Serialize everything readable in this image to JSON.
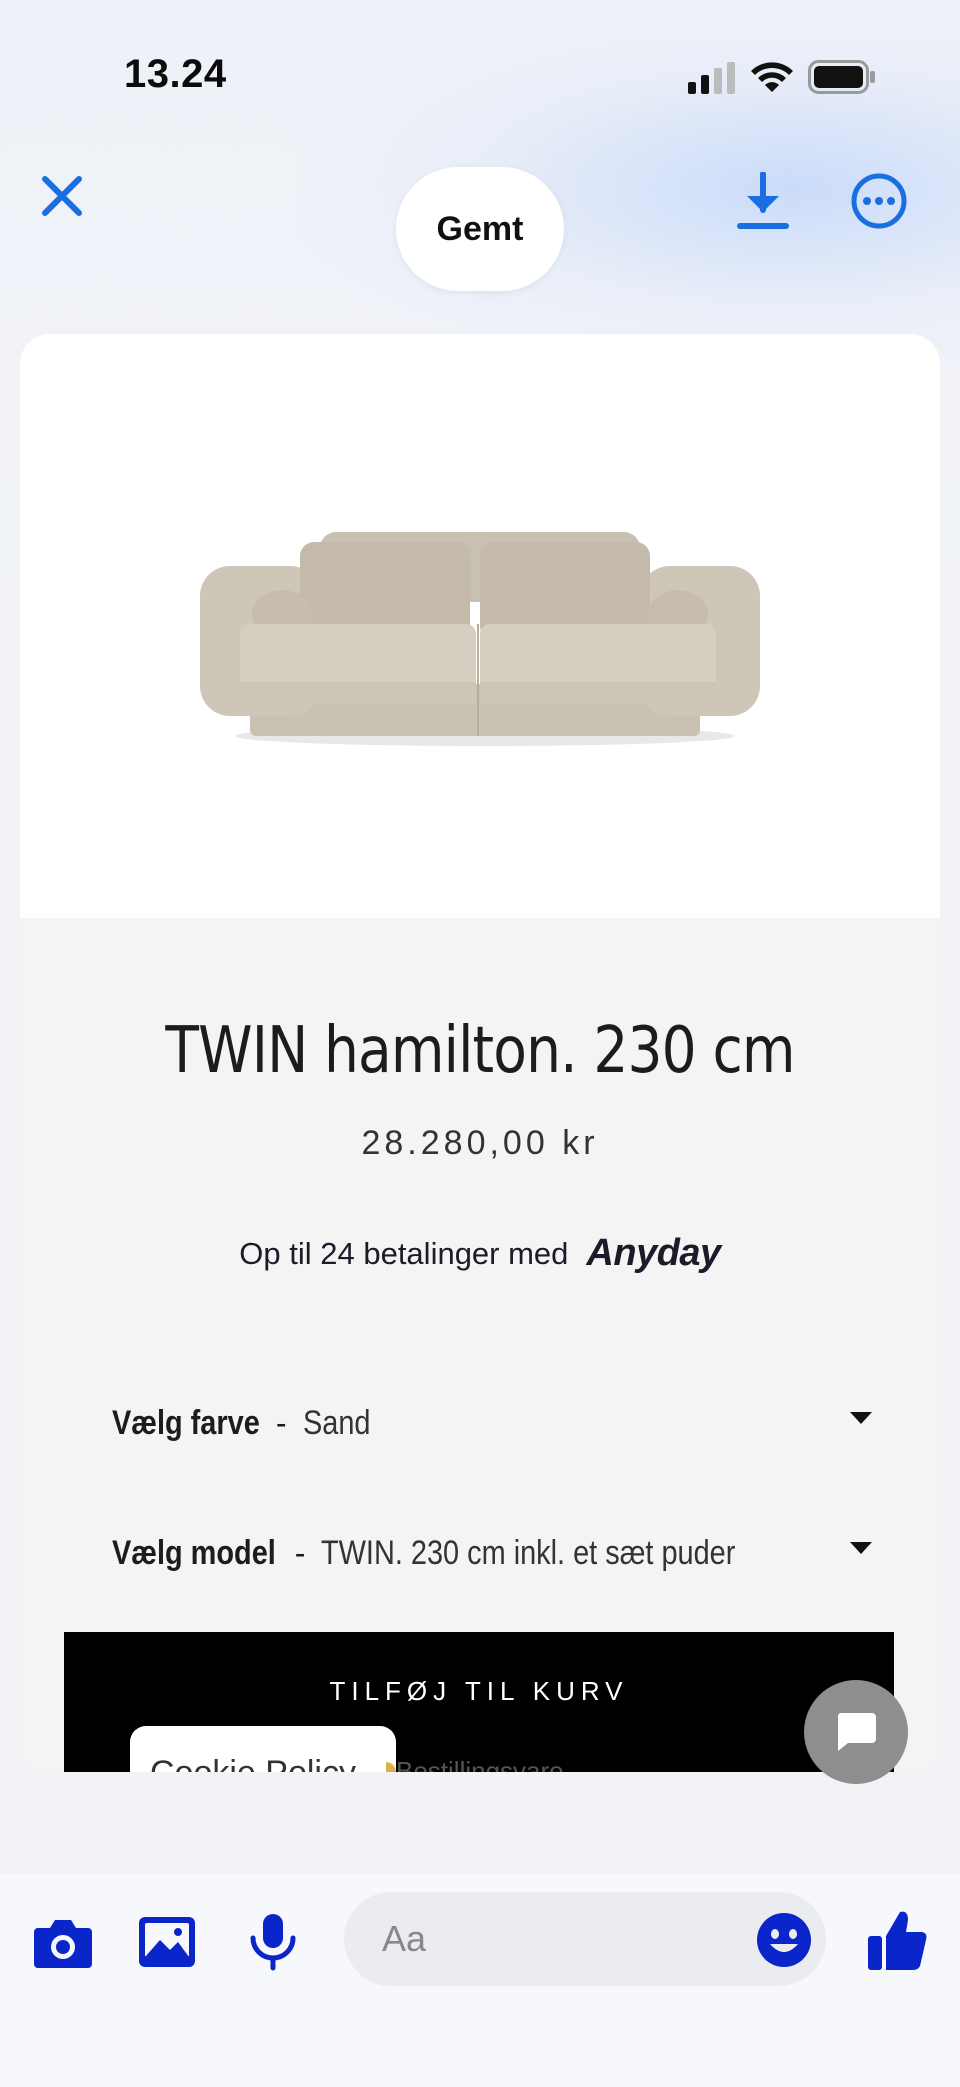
{
  "status_bar": {
    "time": "13.24"
  },
  "top_bar": {
    "saved_label": "Gemt",
    "icons": {
      "close": "close-icon",
      "download": "download-icon",
      "more": "more-icon"
    },
    "accent_color": "#1a6fe0"
  },
  "product": {
    "image": "sofa-image",
    "title": "TWIN hamilton. 230 cm",
    "price": "28.280,00 kr",
    "installments_text": "Op til 24 betalinger med",
    "installments_brand": "Anyday",
    "options": [
      {
        "label": "Vælg farve",
        "separator": "-",
        "value": "Sand"
      },
      {
        "label": "Vælg model",
        "separator": "-",
        "value": "TWIN. 230 cm inkl. et sæt puder"
      }
    ],
    "add_to_cart_label": "TILFØJ TIL KURV",
    "cookie_policy_label": "Cookie Policy",
    "order_note": "Bestillingsvare"
  },
  "composer": {
    "placeholder": "Aa",
    "icons": [
      "camera-icon",
      "gallery-icon",
      "microphone-icon",
      "emoji-icon",
      "thumbs-up-icon"
    ],
    "icon_color": "#0a25c9"
  }
}
